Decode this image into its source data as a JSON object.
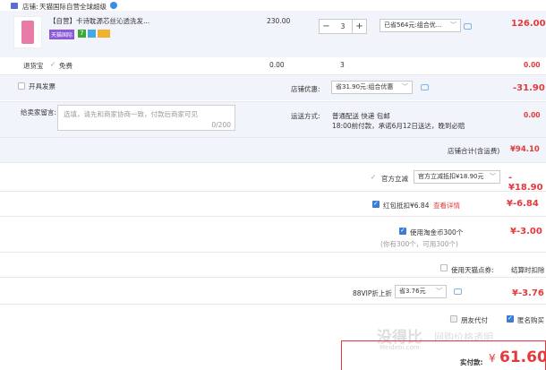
{
  "shop": {
    "label": "店铺:",
    "name": "天猫国际自营全球超级"
  },
  "item": {
    "name": "【自营】卡诗耽源芯丝沁透洗发...",
    "badge_tmall": "天猫国际",
    "price": "230.00",
    "quantity": "3",
    "promo_select": "已省564元:组合优...",
    "subtotal": "126.00"
  },
  "service": {
    "name": "退货宝",
    "option": "免费",
    "price": "0.00",
    "qty": "3",
    "subtotal": "0.00"
  },
  "invoice": {
    "label": "开具发票"
  },
  "shop_discount": {
    "label": "店铺优惠:",
    "select": "省31.90元:组合优惠",
    "amount": "-31.90"
  },
  "message": {
    "label": "给卖家留言:",
    "placeholder": "选填，请先和商家协商一致，付款后商家可见",
    "counter": "0/200"
  },
  "delivery": {
    "label": "运送方式:",
    "method": "普通配送 快递 包邮",
    "note": "18:00前付款，承诺6月12日送达，晚到必赔",
    "fee": "0.00"
  },
  "shop_total": {
    "label": "店铺合计(含运费)",
    "amount": "¥94.10"
  },
  "official": {
    "label": "官方立减",
    "select": "官方立减抵扣¥18.90元",
    "amount": "-¥18.90"
  },
  "redpacket": {
    "label": "红包抵扣¥6.84",
    "link": "查看详情",
    "amount": "¥-6.84"
  },
  "coins": {
    "label": "使用淘金币300个",
    "note": "(你有300个，可用300个)",
    "amount": "¥-3.00"
  },
  "tmall_card": {
    "label": "使用天猫点券:",
    "note": "结算时扣除"
  },
  "vip": {
    "label": "88VIP折上折",
    "select": "省3.76元",
    "amount": "¥-3.76"
  },
  "options": {
    "friend_pay": "朋友代付",
    "anonymous": "匿名购买"
  },
  "pay": {
    "label": "实付款:",
    "currency": "¥",
    "amount": "61.60"
  },
  "watermark": {
    "big": "没得比",
    "sub": "网购价格透明",
    "url": "Meidebi.com"
  },
  "colors": {
    "accent_red": "#e4393c",
    "row_blue": "#f1f5fb",
    "brand_blue": "#3b7cd6"
  }
}
